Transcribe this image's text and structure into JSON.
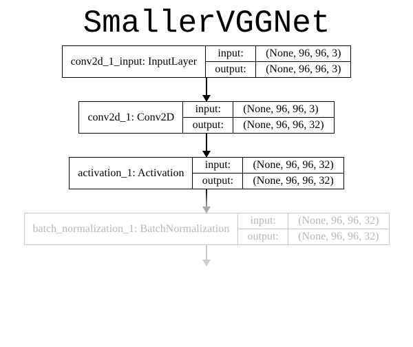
{
  "title": "SmallerVGGNet",
  "io_labels": {
    "input": "input:",
    "output": "output:"
  },
  "nodes": [
    {
      "label": "conv2d_1_input: InputLayer",
      "input": "(None, 96, 96, 3)",
      "output": "(None, 96, 96, 3)",
      "faded": false
    },
    {
      "label": "conv2d_1: Conv2D",
      "input": "(None, 96, 96, 3)",
      "output": "(None, 96, 96, 32)",
      "faded": false
    },
    {
      "label": "activation_1: Activation",
      "input": "(None, 96, 96, 32)",
      "output": "(None, 96, 96, 32)",
      "faded": false
    },
    {
      "label": "batch_normalization_1: BatchNormalization",
      "input": "(None, 96, 96, 32)",
      "output": "(None, 96, 96, 32)",
      "faded": true
    }
  ]
}
